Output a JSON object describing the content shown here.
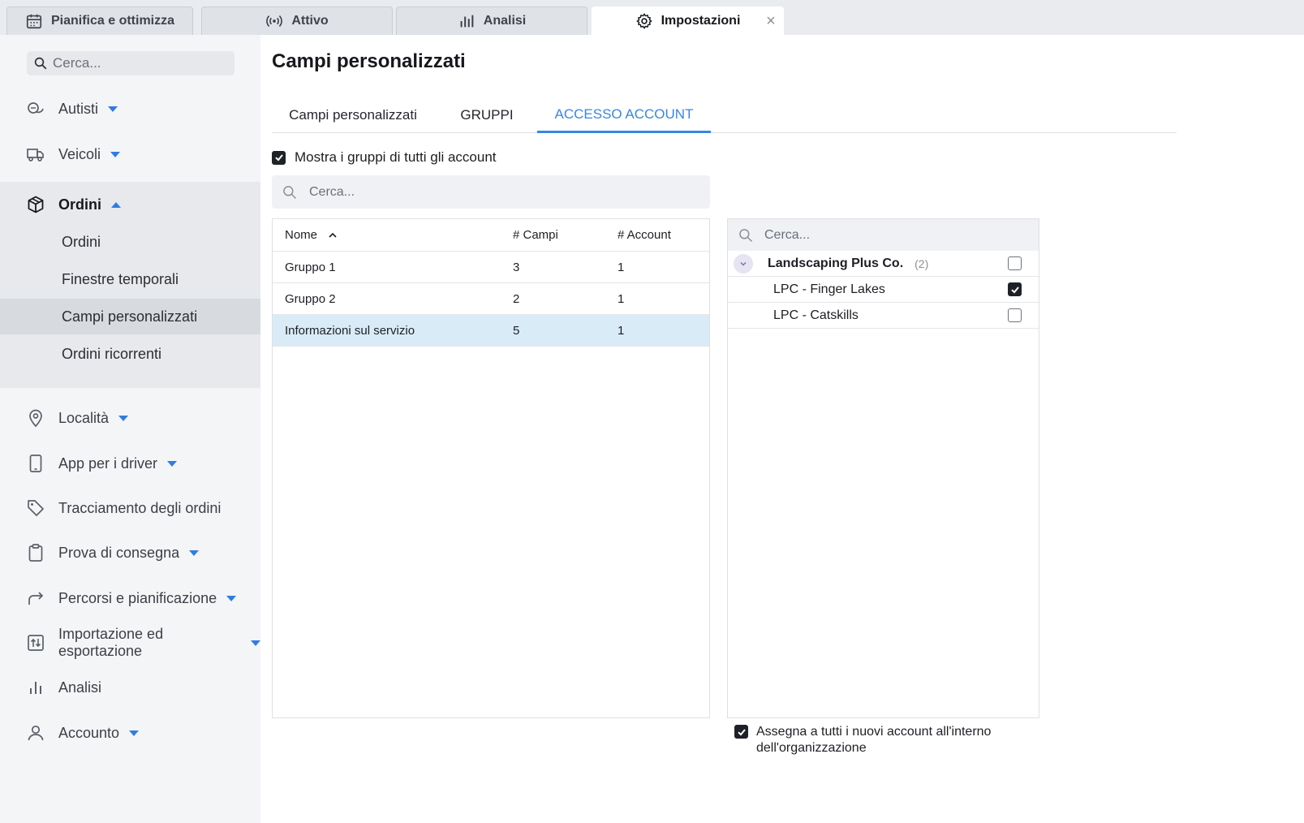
{
  "top_tabs": [
    {
      "label": "Pianifica e ottimizza",
      "icon": "calendar-icon"
    },
    {
      "label": "Attivo",
      "icon": "broadcast-icon"
    },
    {
      "label": "Analisi",
      "icon": "bar-chart-icon"
    },
    {
      "label": "Impostazioni",
      "icon": "gear-icon",
      "active": true
    }
  ],
  "sidebar": {
    "search_placeholder": "Cerca...",
    "items": [
      {
        "label": "Autisti",
        "icon": "drivers-icon"
      },
      {
        "label": "Veicoli",
        "icon": "truck-icon"
      },
      {
        "label": "Ordini",
        "icon": "package-icon",
        "expanded": true
      },
      {
        "label": "Località",
        "icon": "map-pin-icon"
      },
      {
        "label": "App per i driver",
        "icon": "phone-icon"
      },
      {
        "label": "Tracciamento degli ordini",
        "icon": "tag-icon"
      },
      {
        "label": "Prova di consegna",
        "icon": "clipboard-icon"
      },
      {
        "label": "Percorsi e pianificazione",
        "icon": "route-arrow-icon"
      },
      {
        "label": "Importazione ed esportazione",
        "icon": "import-export-icon"
      },
      {
        "label": "Analisi",
        "icon": "bar-chart-icon"
      },
      {
        "label": "Accounto",
        "icon": "user-icon"
      }
    ],
    "ordini_sub": [
      {
        "label": "Ordini"
      },
      {
        "label": "Finestre temporali"
      },
      {
        "label": "Campi personalizzati",
        "selected": true
      },
      {
        "label": "Ordini ricorrenti"
      }
    ]
  },
  "main": {
    "title": "Campi personalizzati",
    "subtabs": [
      "Campi personalizzati",
      "GRUPPI",
      "ACCESSO ACCOUNT"
    ],
    "active_subtab": "ACCESSO ACCOUNT",
    "show_all_label": "Mostra i gruppi di tutti gli account",
    "show_all_checked": true,
    "search_placeholder": "Cerca...",
    "table": {
      "headers": [
        "Nome",
        "# Campi",
        "# Account"
      ],
      "rows": [
        {
          "name": "Gruppo 1",
          "fields": "3",
          "accounts": "1"
        },
        {
          "name": "Gruppo 2",
          "fields": "2",
          "accounts": "1"
        },
        {
          "name": "Informazioni sul servizio",
          "fields": "5",
          "accounts": "1",
          "selected": true
        }
      ]
    },
    "accounts": {
      "search_placeholder": "Cerca...",
      "group": {
        "name": "Landscaping Plus Co.",
        "count": "(2)",
        "checked": false
      },
      "items": [
        {
          "name": "LPC - Finger Lakes",
          "checked": true
        },
        {
          "name": "LPC - Catskills",
          "checked": false
        }
      ]
    },
    "assign_label": "Assegna a tutti i nuovi account all'interno dell'organizzazione",
    "assign_checked": true
  },
  "colors": {
    "accent": "#3a86e0",
    "caret": "#2f7de1",
    "selected_row": "#d9ebf7",
    "sidebar_bg": "#f4f5f7"
  }
}
